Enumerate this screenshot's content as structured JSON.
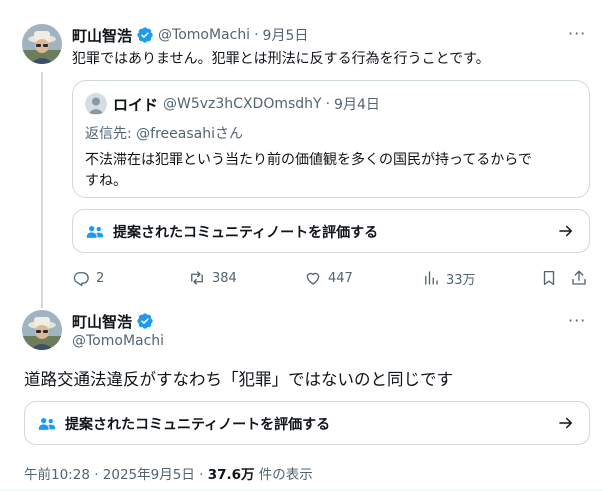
{
  "colors": {
    "verified": "#1d9bf0",
    "text_primary": "#0f1419",
    "text_secondary": "#536471",
    "border": "#cfd9de",
    "community_icon": "#1d9bf0"
  },
  "tweet1": {
    "display_name": "町山智浩",
    "handle": "@TomoMachi",
    "separator": "·",
    "date": "9月5日",
    "text": "犯罪ではありません。犯罪とは刑法に反する行為を行うことです。",
    "more_label": "···",
    "quote": {
      "display_name": "ロイド",
      "handle": "@W5vz3hCXDOmsdhY",
      "separator": "·",
      "date": "9月4日",
      "reply_to": "返信先: @freeasahiさん",
      "text_line1": "不法滞在は犯罪という当たり前の価値観を多くの国民が持ってるからで",
      "text_line2": "すね。"
    },
    "community_note_label": "提案されたコミュニティノートを評価する",
    "actions": {
      "replies": "2",
      "reposts": "384",
      "likes": "447",
      "views": "33万"
    }
  },
  "tweet2": {
    "display_name": "町山智浩",
    "handle": "@TomoMachi",
    "more_label": "···",
    "text": "道路交通法違反がすなわち「犯罪」ではないのと同じです",
    "community_note_label": "提案されたコミュニティノートを評価する",
    "timestamp": "午前10:28 · 2025年9月5日 · ",
    "view_count": "37.6万",
    "view_suffix": " 件の表示"
  },
  "icons": {
    "verified": "verified-badge-icon",
    "community": "community-people-icon",
    "arrow": "arrow-right-icon",
    "reply": "reply-icon",
    "repost": "repost-icon",
    "like": "heart-icon",
    "views": "views-bar-icon",
    "bookmark": "bookmark-icon",
    "share": "share-icon"
  }
}
